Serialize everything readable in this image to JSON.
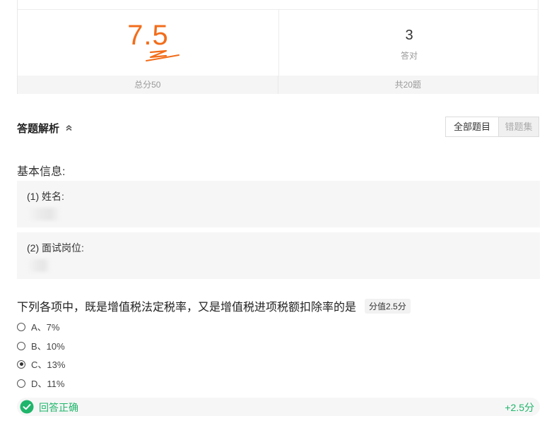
{
  "score_card": {
    "score": "7.5",
    "total_label": "总分50",
    "correct_count": "3",
    "correct_label": "答对",
    "question_count_label": "共20题"
  },
  "analysis": {
    "title": "答题解析",
    "filters": {
      "all": "全部题目",
      "wrong": "错题集"
    }
  },
  "basic_info": {
    "title": "基本信息:",
    "fields": [
      {
        "label": "(1) 姓名:"
      },
      {
        "label": "(2) 面试岗位:"
      }
    ]
  },
  "question": {
    "text": "下列各项中，既是增值税法定税率，又是增值税进项税额扣除率的是",
    "points": "分值2.5分",
    "options": [
      {
        "label": "A、7%",
        "checked": false
      },
      {
        "label": "B、10%",
        "checked": false
      },
      {
        "label": "C、13%",
        "checked": true
      },
      {
        "label": "D、11%",
        "checked": false
      }
    ],
    "result": {
      "status": "回答正确",
      "score": "+2.5分"
    }
  },
  "colors": {
    "score": "#f26d1b",
    "correct": "#1fb56b"
  }
}
